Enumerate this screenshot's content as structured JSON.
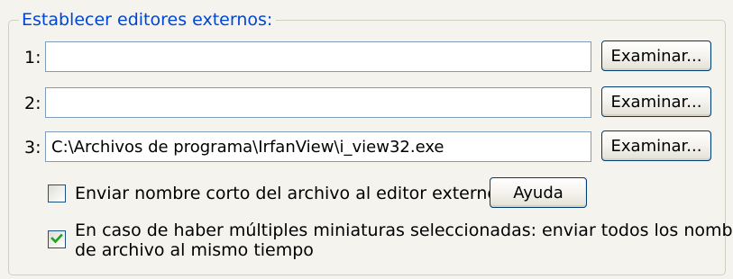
{
  "group": {
    "title": "Establecer editores externos:"
  },
  "editors": [
    {
      "label": "1:",
      "value": "",
      "browse_label": "Examinar..."
    },
    {
      "label": "2:",
      "value": "",
      "browse_label": "Examinar..."
    },
    {
      "label": "3:",
      "value": "C:\\Archivos de programa\\IrfanView\\i_view32.exe",
      "browse_label": "Examinar..."
    }
  ],
  "options": {
    "short_name": {
      "label": "Enviar nombre corto del archivo al editor externo",
      "checked": false
    },
    "help_label": "Ayuda",
    "multiple_files": {
      "label_line1": "En caso de haber múltiples miniaturas seleccionadas: enviar todos los nombres",
      "label_line2": "de archivo al mismo tiempo",
      "checked": true
    }
  },
  "colors": {
    "legend_text": "#0046d5",
    "input_border": "#7f9db9",
    "button_border": "#003c74",
    "checkmark": "#21a121"
  }
}
